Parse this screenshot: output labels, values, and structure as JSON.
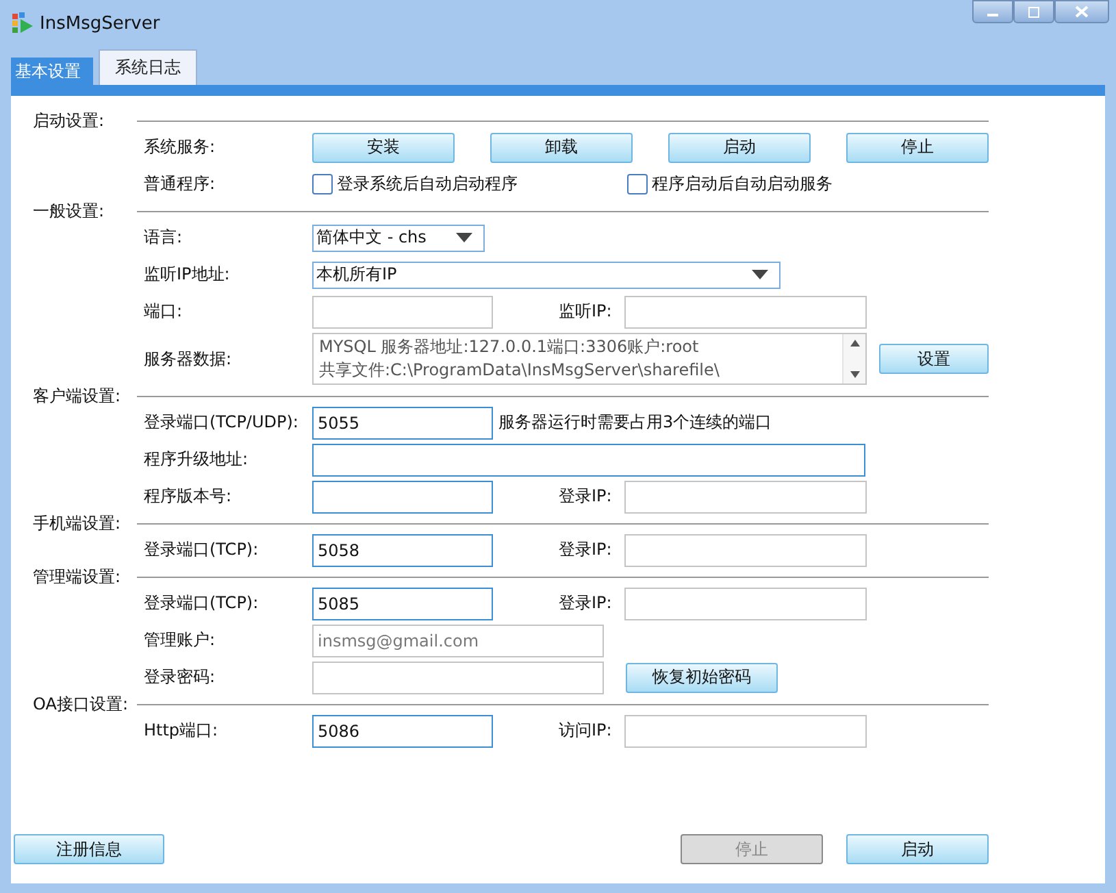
{
  "window": {
    "title": "InsMsgServer"
  },
  "tabs": [
    {
      "label": "基本设置",
      "selected": true
    },
    {
      "label": "系统日志",
      "selected": false
    }
  ],
  "sections": [
    {
      "title": "启动设置:",
      "rows": [
        {
          "kind": "buttons",
          "label": "系统服务:",
          "buttons": [
            {
              "label": "安装",
              "disabled": false
            },
            {
              "label": "卸载",
              "disabled": false
            },
            {
              "label": "启动",
              "disabled": false
            },
            {
              "label": "停止",
              "disabled": false
            }
          ]
        },
        {
          "kind": "checks",
          "label": "普通程序:",
          "checks": [
            {
              "label": "登录系统后自动启动程序",
              "checked": false
            },
            {
              "label": "程序启动后自动启动服务",
              "checked": false
            }
          ]
        }
      ]
    },
    {
      "title": "一般设置:",
      "rows": [
        {
          "kind": "select",
          "label": "语言:",
          "value": "简体中文 - chs"
        },
        {
          "kind": "wideselect",
          "label": "监听IP地址:",
          "value": "本机所有IP"
        },
        {
          "kind": "pair",
          "label": "端口:",
          "field": {
            "enabled": false
          },
          "label2": "监听IP:",
          "field2": {
            "enabled": false
          }
        },
        {
          "kind": "textarea",
          "label": "服务器数据:",
          "lines": [
            "MYSQL 服务器地址:127.0.0.1端口:3306账户:root",
            "共享文件:C:\\ProgramData\\InsMsgServer\\sharefile\\"
          ],
          "button": {
            "label": "设置",
            "disabled": false
          }
        }
      ]
    },
    {
      "title": "客户端设置:",
      "rows": [
        {
          "kind": "note",
          "label": "登录端口(TCP/UDP):",
          "field": {
            "value": "5055",
            "enabled": true
          },
          "note": "服务器运行时需要占用3个连续的端口"
        },
        {
          "kind": "wide",
          "label": "程序升级地址:",
          "field": {
            "enabled": true
          }
        },
        {
          "kind": "pair",
          "label": "程序版本号:",
          "field": {
            "enabled": true
          },
          "label2": "登录IP:",
          "field2": {
            "enabled": false
          }
        }
      ]
    },
    {
      "title": "手机端设置:",
      "rows": [
        {
          "kind": "pair",
          "label": "登录端口(TCP):",
          "field": {
            "value": "5058",
            "enabled": true
          },
          "label2": "登录IP:",
          "field2": {
            "enabled": false
          }
        }
      ]
    },
    {
      "title": "管理端设置:",
      "rows": [
        {
          "kind": "pair",
          "label": "登录端口(TCP):",
          "field": {
            "value": "5085",
            "enabled": true
          },
          "label2": "登录IP:",
          "field2": {
            "enabled": false
          }
        },
        {
          "kind": "medium",
          "label": "管理账户:",
          "field": {
            "value": "insmsg@gmail.com",
            "enabled": false
          }
        },
        {
          "kind": "medium",
          "label": "登录密码:",
          "field": {
            "enabled": false
          },
          "button": {
            "label": "恢复初始密码",
            "disabled": false
          }
        }
      ]
    },
    {
      "title": "OA接口设置:",
      "rows": [
        {
          "kind": "pair",
          "label": "Http端口:",
          "field": {
            "value": "5086",
            "enabled": true
          },
          "label2": "访问IP:",
          "field2": {
            "enabled": false
          }
        }
      ]
    }
  ],
  "footer": {
    "left": {
      "label": "注册信息",
      "disabled": false
    },
    "right": [
      {
        "label": "停止",
        "disabled": true
      },
      {
        "label": "启动",
        "disabled": false
      }
    ]
  }
}
